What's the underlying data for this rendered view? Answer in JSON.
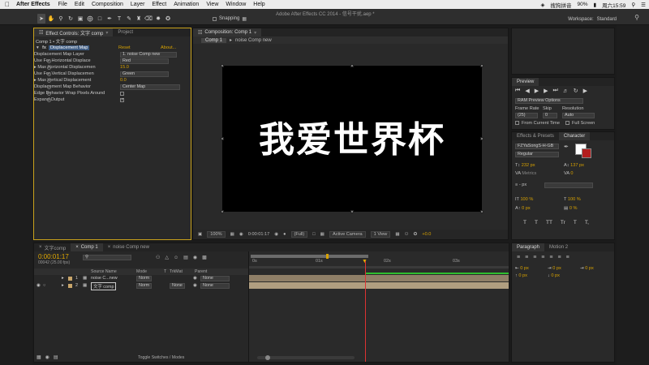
{
  "menubar": {
    "app_name": "After Effects",
    "menus": [
      "File",
      "Edit",
      "Composition",
      "Layer",
      "Effect",
      "Animation",
      "View",
      "Window",
      "Help"
    ],
    "input_method": "搜狗拼音",
    "battery": "90%",
    "clock": "周六15:59"
  },
  "toolbar": {
    "snapping_label": "Snapping",
    "doc_title": "Adobe After Effects CC 2014 - 信号干扰.aep *",
    "workspace_label": "Workspace:",
    "workspace_value": "Standard"
  },
  "effect_controls": {
    "tab_label": "Effect Controls: 文字 comp",
    "tab_project": "Project",
    "breadcrumb": "Comp 1 • 文字 comp",
    "effect_name": "Displacement Map",
    "reset_label": "Reset",
    "about_label": "About...",
    "props": {
      "map_layer_label": "Displacement Map Layer",
      "map_layer_value": "1. noise Comp new",
      "use_h_label": "Use For Horizontal Displace",
      "use_h_value": "Red",
      "max_h_label": "Max Horizontal Displacemen",
      "max_h_value": "15.0",
      "use_v_label": "Use For Vertical Displacemen",
      "use_v_value": "Green",
      "max_v_label": "Max Vertical Displacement",
      "max_v_value": "0.0",
      "behavior_label": "Displacement Map Behavior",
      "behavior_value": "Center Map",
      "edge_label": "Edge Behavior",
      "wrap_label": "Wrap Pixels Around",
      "expand_label": "Expand Output"
    }
  },
  "composition": {
    "tab_label": "Composition: Comp 1",
    "sub_tab_1": "Comp 1",
    "sub_tab_2": "noise Comp new",
    "canvas_text": "我爱世界杯",
    "viewer": {
      "zoom": "100%",
      "timecode": "0:00:01:17",
      "resolution": "(Full)",
      "camera": "Active Camera",
      "views": "1 View",
      "exposure": "+0.0"
    }
  },
  "preview": {
    "tab_label": "Preview",
    "ram_options": "RAM Preview Options",
    "frame_rate_label": "Frame Rate",
    "skip_label": "Skip",
    "resolution_label": "Resolution",
    "frame_rate_value": "(25)",
    "skip_value": "0",
    "resolution_value": "Auto",
    "from_current_label": "From Current Time",
    "full_screen_label": "Full Screen"
  },
  "character": {
    "tab_effects": "Effects & Presets",
    "tab_character": "Character",
    "font_value": "FZYaSongS-H-GB",
    "style_value": "Regular",
    "size_value": "232 px",
    "leading_value": "137 px",
    "kerning_label": "Metrics",
    "tracking_value": "0",
    "stroke_value": "- px",
    "vscale_value": "100 %",
    "hscale_value": "100 %",
    "baseline_value": "0 px",
    "tsume_value": "0 %",
    "style_buttons": [
      "T",
      "T",
      "TT",
      "Tr",
      "T",
      "T,"
    ]
  },
  "paragraph": {
    "tab_paragraph": "Paragraph",
    "tab_motion": "Motion 2",
    "indent_values": [
      "0 px",
      "0 px",
      "0 px",
      "0 px",
      "0 px"
    ]
  },
  "timeline": {
    "tab_1": "文字comp",
    "tab_2": "Comp 1",
    "tab_3": "noise Comp new",
    "timecode": "0:00:01:17",
    "frames_label": "00042 (25.00 fps)",
    "col_source": "Source Name",
    "col_mode": "Mode",
    "col_t": "T",
    "col_trkmat": "TrkMat",
    "col_parent": "Parent",
    "layers": [
      {
        "index": "1",
        "name": "noise C...new",
        "mode": "Norm",
        "trkmat": "",
        "parent": "None"
      },
      {
        "index": "2",
        "name": "文字 comp",
        "mode": "Norm",
        "trkmat": "None",
        "parent": "None"
      }
    ],
    "ruler": [
      "0s",
      "01s",
      "02s",
      "03s"
    ],
    "toggle_label": "Toggle Switches / Modes"
  }
}
